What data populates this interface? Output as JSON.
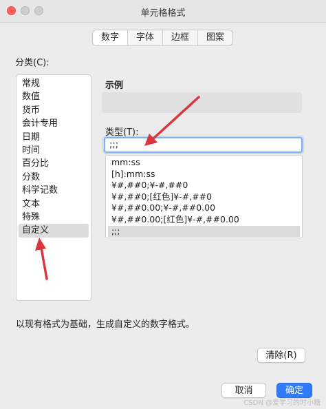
{
  "window": {
    "title": "单元格格式"
  },
  "tabs": [
    {
      "label": "数字",
      "active": true
    },
    {
      "label": "字体",
      "active": false
    },
    {
      "label": "边框",
      "active": false
    },
    {
      "label": "图案",
      "active": false
    }
  ],
  "category": {
    "label": "分类(C):",
    "items": [
      "常规",
      "数值",
      "货币",
      "会计专用",
      "日期",
      "时间",
      "百分比",
      "分数",
      "科学记数",
      "文本",
      "特殊",
      "自定义"
    ],
    "selected": "自定义"
  },
  "sample": {
    "label": "示例",
    "value": ""
  },
  "type": {
    "label": "类型(T):",
    "value": ";;;",
    "list": [
      "mm:ss",
      "[h]:mm:ss",
      "¥#,##0;¥-#,##0",
      "¥#,##0;[红色]¥-#,##0",
      "¥#,##0.00;¥-#,##0.00",
      "¥#,##0.00;[红色]¥-#,##0.00",
      ";;;"
    ],
    "selected": ";;;"
  },
  "description": "以现有格式为基础，生成自定义的数字格式。",
  "buttons": {
    "clear": "清除(R)",
    "cancel": "取消",
    "ok": "确定"
  },
  "watermark": "CSDN @爱学习的时小糖",
  "colors": {
    "annotation_arrow": "#d9363e",
    "accent": "#2f7cf6",
    "focus_ring": "#7fb3ee"
  }
}
